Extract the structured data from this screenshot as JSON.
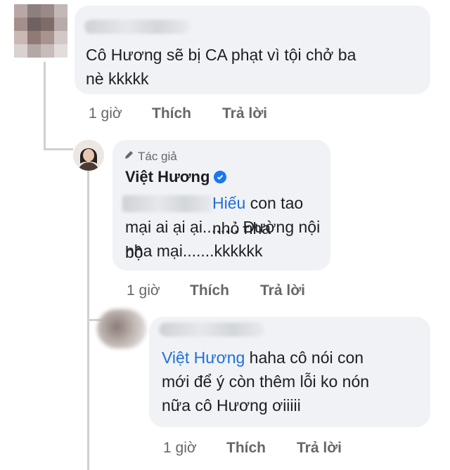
{
  "comment1": {
    "text_line1": "Cô Hương sẽ bị CA phạt vì tội chở ba",
    "text_line2": "nè kkkkk",
    "time": "1 giờ",
    "like": "Thích",
    "reply": "Trả lời"
  },
  "reply1": {
    "badge": "Tác giả",
    "author": "Việt Hương",
    "mention": "Hiếu",
    "text_line1_rest": " con tao nhỏ nha",
    "text_line2": "mại ai ại ại........ Đường nội bộ",
    "text_line3": "nha mại.......kkkkkk",
    "time": "1 giờ",
    "like": "Thích",
    "reply": "Trả lời"
  },
  "reply2": {
    "mention": "Việt Hương",
    "text_line1_rest": " haha cô nói con",
    "text_line2": "mới để ý còn thêm lỗi ko nón",
    "text_line3": "nữa cô Hương ơiiiii",
    "time": "1 giờ",
    "like": "Thích",
    "reply": "Trả lời"
  },
  "colors": {
    "bubble": "#f0f2f5",
    "mention": "#216fdb",
    "meta": "#65676b",
    "verified": "#1877f2"
  }
}
